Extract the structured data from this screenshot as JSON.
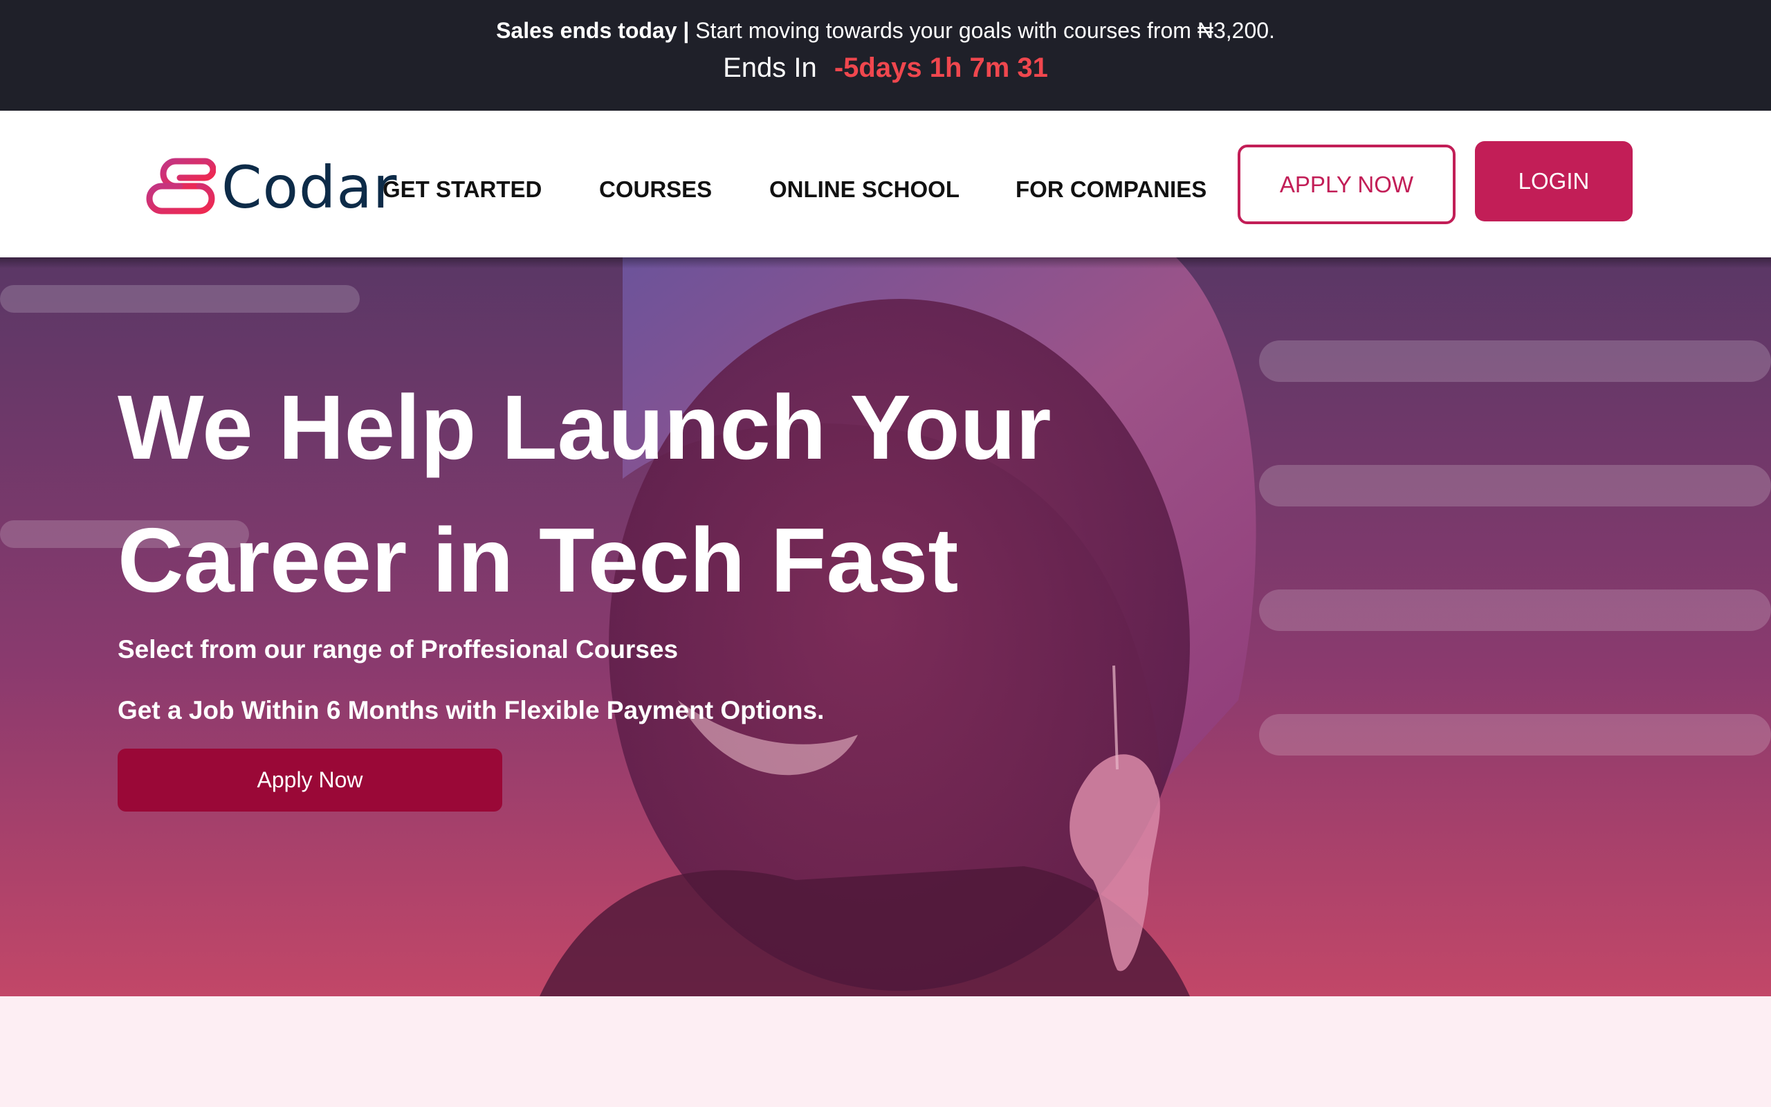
{
  "promo": {
    "bold": "Sales ends today",
    "separator": " | ",
    "text": "Start moving towards your goals with courses from ₦3,200.",
    "ends_label": "Ends In",
    "countdown": "-5days 1h 7m 31"
  },
  "header": {
    "logo_text": "Codar",
    "nav": [
      "GET STARTED",
      "COURSES",
      "ONLINE SCHOOL",
      "FOR COMPANIES"
    ],
    "apply_label": "APPLY NOW",
    "login_label": "LOGIN"
  },
  "hero": {
    "title_line1": "We Help Launch Your",
    "title_line2": "Career in Tech Fast",
    "sub1": "Select from our range of Proffesional Courses",
    "sub2": "Get a Job Within 6 Months with Flexible Payment Options.",
    "cta_label": "Apply Now"
  },
  "colors": {
    "banner_bg": "#1f2029",
    "countdown": "#f0474e",
    "brand": "#c21e57",
    "cta": "#9a0837",
    "logo_text": "#0d2b48",
    "page_bg": "#fdeef3"
  },
  "icons": {
    "logo_mark": "codar-logo-mark"
  }
}
